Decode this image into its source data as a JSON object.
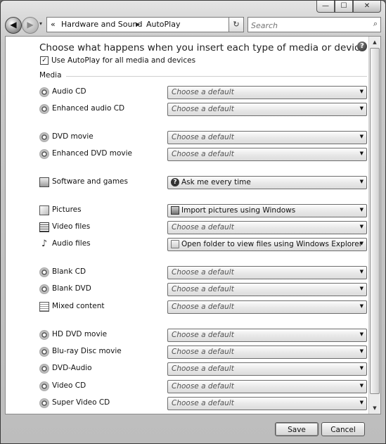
{
  "window_controls": {
    "minimize": "—",
    "maximize": "☐",
    "close": "✕"
  },
  "nav": {
    "back": "◀",
    "forward": "▶",
    "dropdown": "▾"
  },
  "address": {
    "chevrons": "«",
    "seg1": "Hardware and Sound",
    "sep": "▶",
    "seg2": "AutoPlay",
    "dropdown": "▾"
  },
  "refresh": "↻",
  "search": {
    "placeholder": "Search",
    "icon": "⌕"
  },
  "page": {
    "heading": "Choose what happens when you insert each type of media or device",
    "help": "?",
    "checkbox_label": "Use AutoPlay for all media and devices",
    "checkbox_mark": "✓",
    "section_label": "Media"
  },
  "rows": [
    {
      "label": "Audio CD",
      "value": "Choose a default",
      "icon": "disc-icon"
    },
    {
      "label": "Enhanced audio CD",
      "value": "Choose a default",
      "icon": "disc-icon"
    },
    {
      "label": "DVD movie",
      "value": "Choose a default",
      "icon": "disc-icon"
    },
    {
      "label": "Enhanced DVD movie",
      "value": "Choose a default",
      "icon": "disc-icon"
    },
    {
      "label": "Software and games",
      "value": "Ask me every time",
      "icon": "software-icon",
      "value_icon": "question-icon"
    },
    {
      "label": "Pictures",
      "value": "Import pictures using Windows",
      "icon": "pictures-icon",
      "value_icon": "camera-icon"
    },
    {
      "label": "Video files",
      "value": "Choose a default",
      "icon": "film-icon"
    },
    {
      "label": "Audio files",
      "value": "Open folder to view files using Windows Explorer",
      "icon": "music-note-icon",
      "value_icon": "folder-icon"
    },
    {
      "label": "Blank CD",
      "value": "Choose a default",
      "icon": "disc-icon"
    },
    {
      "label": "Blank DVD",
      "value": "Choose a default",
      "icon": "disc-icon"
    },
    {
      "label": "Mixed content",
      "value": "Choose a default",
      "icon": "document-icon"
    },
    {
      "label": "HD DVD movie",
      "value": "Choose a default",
      "icon": "disc-icon"
    },
    {
      "label": "Blu-ray Disc movie",
      "value": "Choose a default",
      "icon": "disc-icon"
    },
    {
      "label": "DVD-Audio",
      "value": "Choose a default",
      "icon": "disc-icon"
    },
    {
      "label": "Video CD",
      "value": "Choose a default",
      "icon": "disc-icon"
    },
    {
      "label": "Super Video CD",
      "value": "Choose a default",
      "icon": "disc-icon"
    }
  ],
  "dropdown_arrow": "▼",
  "scroll": {
    "up": "▲",
    "down": "▼"
  },
  "buttons": {
    "save": "Save",
    "cancel": "Cancel"
  }
}
